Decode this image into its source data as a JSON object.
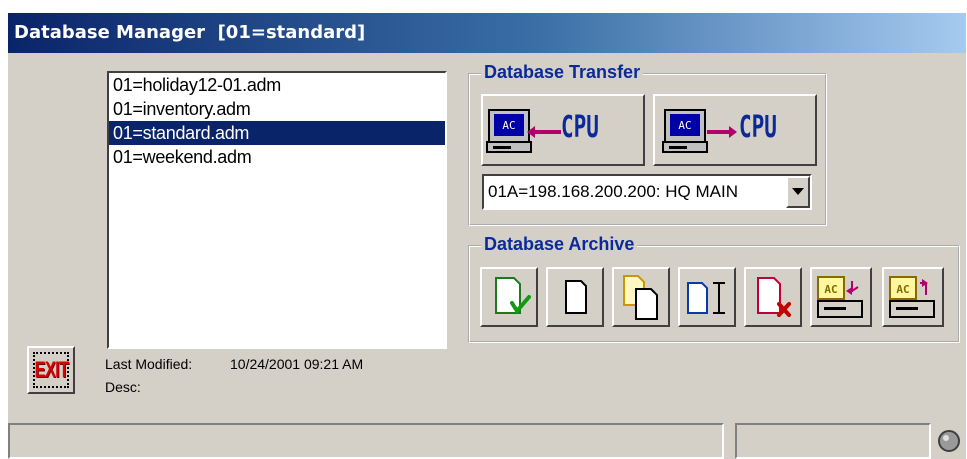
{
  "window": {
    "title": "Database Manager  [01=standard]"
  },
  "file_list": {
    "items": [
      {
        "label": "01=holiday12-01.adm",
        "selected": false
      },
      {
        "label": "01=inventory.adm",
        "selected": false
      },
      {
        "label": "01=standard.adm",
        "selected": true
      },
      {
        "label": "01=weekend.adm",
        "selected": false
      }
    ]
  },
  "exit_button": {
    "label": "EXIT"
  },
  "details": {
    "last_modified_label": "Last Modified:",
    "last_modified_value": "10/24/2001 09:21 AM",
    "desc_label": "Desc:",
    "desc_value": ""
  },
  "transfer": {
    "group_label": "Database Transfer",
    "to_pc": {
      "pc_label": "AC",
      "cpu_label": "CPU",
      "icon": "download-from-cpu-icon"
    },
    "to_cpu": {
      "pc_label": "AC",
      "cpu_label": "CPU",
      "icon": "upload-to-cpu-icon"
    },
    "connection_value": "01A=198.168.200.200: HQ MAIN"
  },
  "archive": {
    "group_label": "Database Archive",
    "buttons": [
      {
        "icon": "verify-document-icon"
      },
      {
        "icon": "new-document-icon"
      },
      {
        "icon": "copy-document-icon"
      },
      {
        "icon": "rename-document-icon"
      },
      {
        "icon": "delete-document-icon"
      },
      {
        "icon": "archive-save-icon",
        "pc_label": "AC"
      },
      {
        "icon": "archive-restore-icon",
        "pc_label": "AC"
      }
    ]
  },
  "colors": {
    "title_gradient_start": "#0a246a",
    "title_gradient_end": "#a6caf0",
    "face": "#d4d0c8",
    "group_label": "#0b2a9a",
    "selection": "#0a246a",
    "exit_red": "#d80000"
  }
}
